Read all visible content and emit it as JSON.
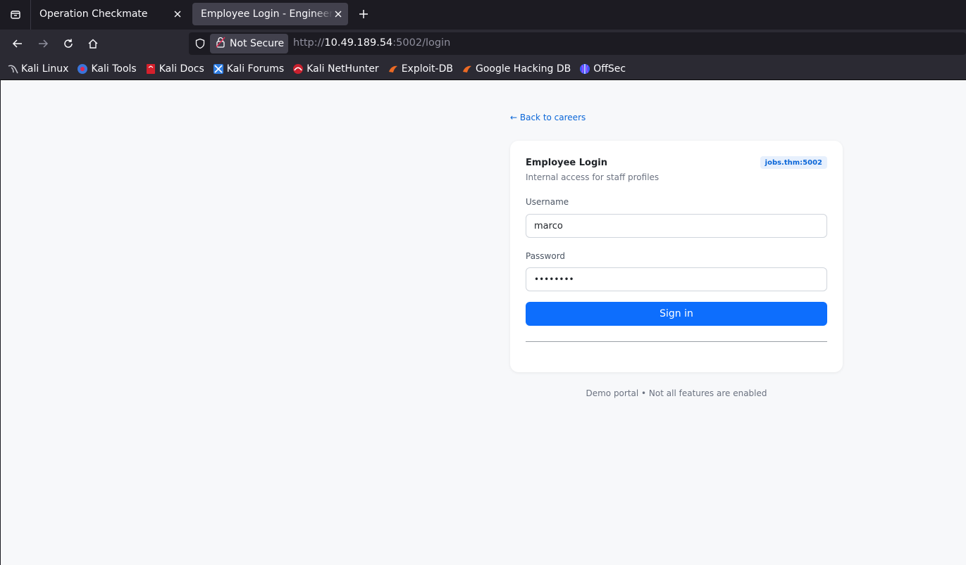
{
  "browser": {
    "tabs": [
      {
        "title": "Operation Checkmate",
        "active": false
      },
      {
        "title": "Employee Login - Engineering",
        "active": true
      }
    ],
    "security_label": "Not Secure",
    "url": {
      "scheme": "http://",
      "host": "10.49.189.54",
      "rest": ":5002/login"
    },
    "bookmarks": [
      {
        "label": "Kali Linux",
        "icon": "kali-dragon-icon"
      },
      {
        "label": "Kali Tools",
        "icon": "kali-tools-icon"
      },
      {
        "label": "Kali Docs",
        "icon": "kali-docs-icon"
      },
      {
        "label": "Kali Forums",
        "icon": "kali-forums-icon"
      },
      {
        "label": "Kali NetHunter",
        "icon": "kali-nethunter-icon"
      },
      {
        "label": "Exploit-DB",
        "icon": "exploit-db-icon"
      },
      {
        "label": "Google Hacking DB",
        "icon": "ghdb-icon"
      },
      {
        "label": "OffSec",
        "icon": "offsec-icon"
      }
    ]
  },
  "page": {
    "back_link": "← Back to careers",
    "card": {
      "title": "Employee Login",
      "subtitle": "Internal access for staff profiles",
      "host_tag": "jobs.thm:5002",
      "username_label": "Username",
      "username_value": "marco",
      "password_label": "Password",
      "password_value": "••••••••",
      "signin_label": "Sign in"
    },
    "footnote": "Demo portal • Not all features are enabled"
  },
  "colors": {
    "accent": "#0d6efd",
    "link": "#0a66d8",
    "page_bg": "#f7f8fa",
    "chrome_dark": "#1c1b22",
    "chrome_toolbar": "#2b2a33"
  }
}
